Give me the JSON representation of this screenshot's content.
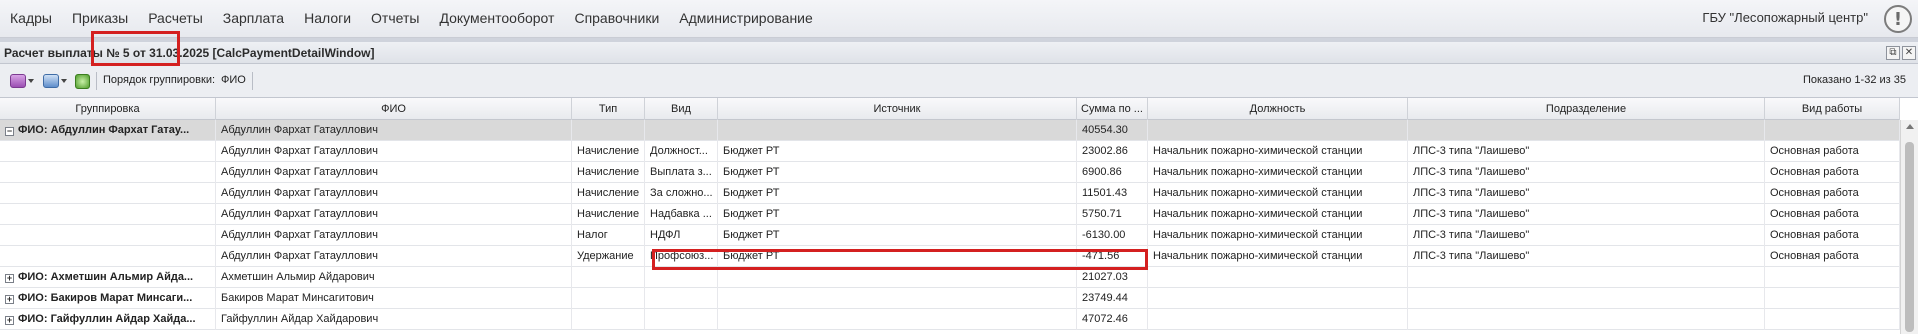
{
  "nav": {
    "items": [
      "Кадры",
      "Приказы",
      "Расчеты",
      "Зарплата",
      "Налоги",
      "Отчеты",
      "Документооборот",
      "Справочники",
      "Администрирование"
    ],
    "org": "ГБУ \"Лесопожарный центр\"",
    "help_symbol": "!"
  },
  "window": {
    "title": "Расчет выплаты № 5 от 31.03.2025 [CalcPaymentDetailWindow]",
    "restore_symbol": "⧉",
    "close_symbol": "✕"
  },
  "toolbar": {
    "group_order_label": "Порядок группировки:",
    "group_order_value": "ФИО",
    "shown": "Показано 1-32 из 35"
  },
  "grid": {
    "columns": [
      "Группировка",
      "ФИО",
      "Тип",
      "Вид",
      "Источник",
      "Сумма по ...",
      "Должность",
      "Подразделение",
      "Вид работы"
    ],
    "rows": [
      {
        "kind": "group",
        "expanded": true,
        "selected": true,
        "group": "ФИО: Абдуллин Фархат Гатау...",
        "fio": "Абдуллин Фархат Гатауллович",
        "type": "",
        "kind2": "",
        "source": "",
        "sum": "40554.30",
        "position": "",
        "dept": "",
        "work": ""
      },
      {
        "kind": "item",
        "group": "",
        "fio": "Абдуллин Фархат Гатауллович",
        "type": "Начисление",
        "kind2": "Должност...",
        "source": "Бюджет РТ",
        "sum": "23002.86",
        "position": "Начальник пожарно-химической станции",
        "dept": "ЛПС-3 типа \"Лаишево\"",
        "work": "Основная работа"
      },
      {
        "kind": "item",
        "group": "",
        "fio": "Абдуллин Фархат Гатауллович",
        "type": "Начисление",
        "kind2": "Выплата з...",
        "source": "Бюджет РТ",
        "sum": "6900.86",
        "position": "Начальник пожарно-химической станции",
        "dept": "ЛПС-3 типа \"Лаишево\"",
        "work": "Основная работа"
      },
      {
        "kind": "item",
        "group": "",
        "fio": "Абдуллин Фархат Гатауллович",
        "type": "Начисление",
        "kind2": "За сложно...",
        "source": "Бюджет РТ",
        "sum": "11501.43",
        "position": "Начальник пожарно-химической станции",
        "dept": "ЛПС-3 типа \"Лаишево\"",
        "work": "Основная работа"
      },
      {
        "kind": "item",
        "group": "",
        "fio": "Абдуллин Фархат Гатауллович",
        "type": "Начисление",
        "kind2": "Надбавка ...",
        "source": "Бюджет РТ",
        "sum": "5750.71",
        "position": "Начальник пожарно-химической станции",
        "dept": "ЛПС-3 типа \"Лаишево\"",
        "work": "Основная работа"
      },
      {
        "kind": "item",
        "group": "",
        "fio": "Абдуллин Фархат Гатауллович",
        "type": "Налог",
        "kind2": "НДФЛ",
        "source": "Бюджет РТ",
        "sum": "-6130.00",
        "position": "Начальник пожарно-химической станции",
        "dept": "ЛПС-3 типа \"Лаишево\"",
        "work": "Основная работа"
      },
      {
        "kind": "item",
        "group": "",
        "fio": "Абдуллин Фархат Гатауллович",
        "type": "Удержание",
        "kind2": "Профсоюз...",
        "source": "Бюджет РТ",
        "sum": "-471.56",
        "position": "Начальник пожарно-химической станции",
        "dept": "ЛПС-3 типа \"Лаишево\"",
        "work": "Основная работа"
      },
      {
        "kind": "group",
        "expanded": false,
        "group": "ФИО: Ахметшин Альмир Айда...",
        "fio": "Ахметшин Альмир Айдарович",
        "type": "",
        "kind2": "",
        "source": "",
        "sum": "21027.03",
        "position": "",
        "dept": "",
        "work": ""
      },
      {
        "kind": "group",
        "expanded": false,
        "group": "ФИО: Бакиров Марат Минсаги...",
        "fio": "Бакиров Марат Минсагитович",
        "type": "",
        "kind2": "",
        "source": "",
        "sum": "23749.44",
        "position": "",
        "dept": "",
        "work": ""
      },
      {
        "kind": "group",
        "expanded": false,
        "group": "ФИО: Гайфуллин Айдар Хайда...",
        "fio": "Гайфуллин Айдар Хайдарович",
        "type": "",
        "kind2": "",
        "source": "",
        "sum": "47072.46",
        "position": "",
        "dept": "",
        "work": ""
      }
    ]
  }
}
